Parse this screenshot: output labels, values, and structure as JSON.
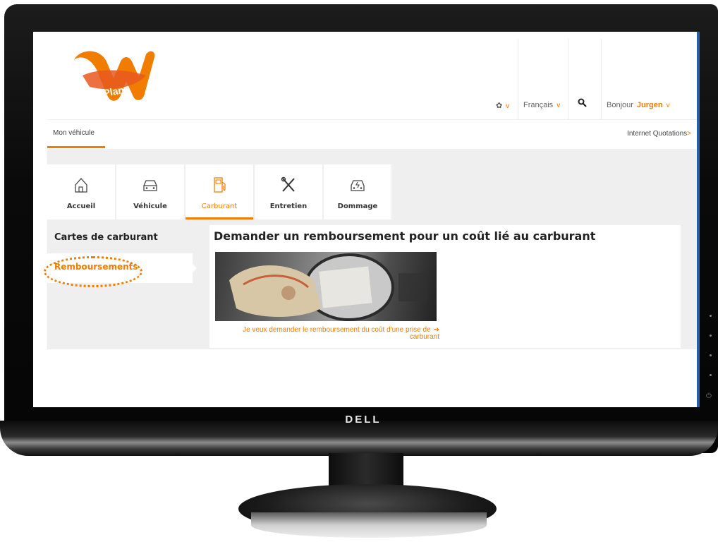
{
  "monitor": {
    "brand": "DELL"
  },
  "header": {
    "logo_text": "LeasePlan",
    "language": "Français",
    "greeting": "Bonjour",
    "user_name": "Jurgen",
    "chevron": "v"
  },
  "subnav": {
    "active_tab": "Mon véhicule",
    "right_link": "Internet Quotations",
    "right_link_arrow": ">"
  },
  "main_tabs": [
    {
      "label": "Accueil",
      "icon": "home-icon"
    },
    {
      "label": "Véhicule",
      "icon": "car-icon"
    },
    {
      "label": "Carburant",
      "icon": "fuel-pump-icon",
      "active": true
    },
    {
      "label": "Entretien",
      "icon": "tools-icon"
    },
    {
      "label": "Dommage",
      "icon": "damaged-car-icon"
    }
  ],
  "left_nav": {
    "items": [
      {
        "label": "Cartes de carburant"
      },
      {
        "label": "Remboursements",
        "active": true
      }
    ]
  },
  "content": {
    "title": "Demander un remboursement pour un coût lié au carburant",
    "link_line1": "Je veux demander le remboursement du coût d'une prise de",
    "link_line2": "carburant",
    "link_arrow": "➔"
  },
  "colors": {
    "accent": "#f07d00",
    "gray_bg": "#efefef",
    "screen_border": "#2a5fa8"
  }
}
